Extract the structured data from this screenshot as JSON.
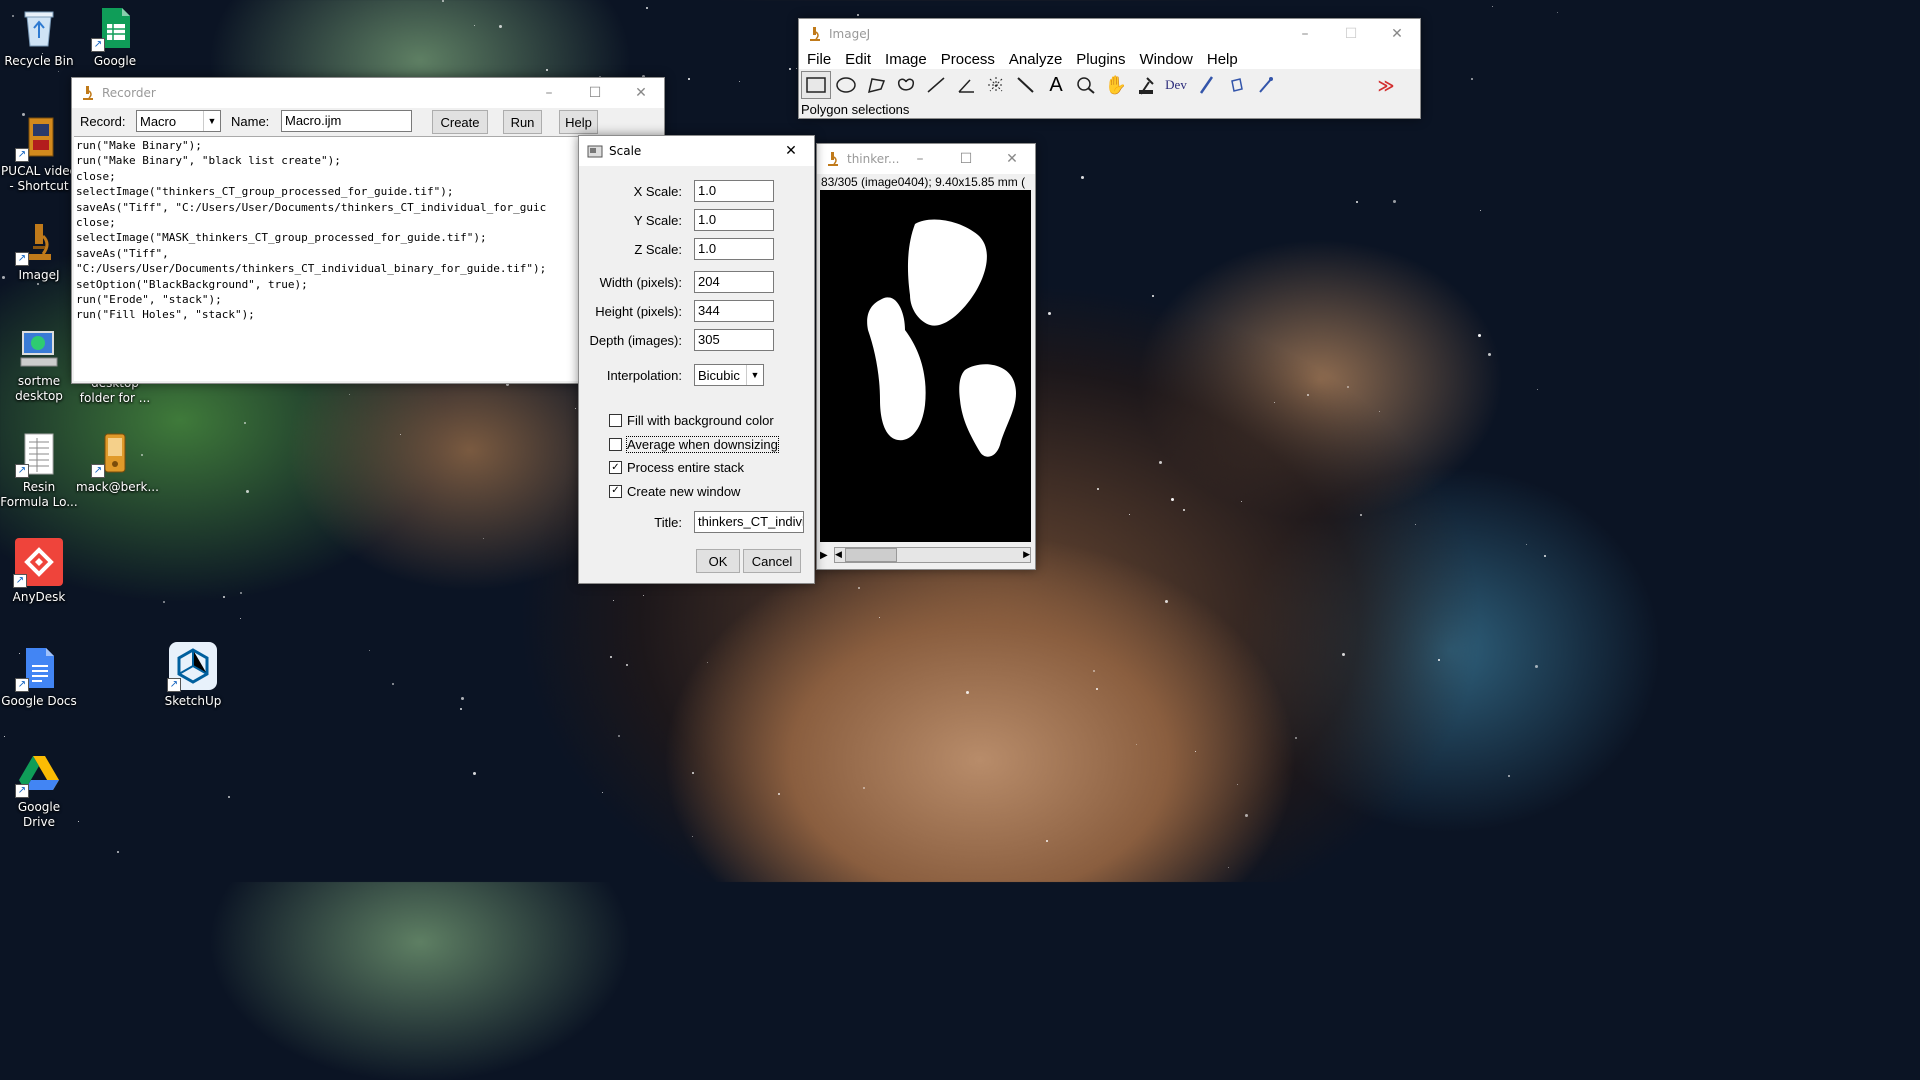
{
  "desktop": {
    "icons": [
      {
        "label": "Recycle Bin"
      },
      {
        "label": "Google"
      },
      {
        "label": "PUCAL video - Shortcut"
      },
      {
        "label": "ImageJ"
      },
      {
        "label": "sortme desktop"
      },
      {
        "label": "desktop folder for ..."
      },
      {
        "label": "Resin Formula Lo..."
      },
      {
        "label": "mack@berk..."
      },
      {
        "label": "AnyDesk"
      },
      {
        "label": "Google Docs"
      },
      {
        "label": "SketchUp"
      },
      {
        "label": "Google Drive"
      }
    ]
  },
  "recorder": {
    "title": "Recorder",
    "record_label": "Record:",
    "record_value": "Macro",
    "name_label": "Name:",
    "name_value": "Macro.ijm",
    "create_label": "Create",
    "run_label": "Run",
    "help_label": "Help",
    "code_lines": [
      "run(\"Make Binary\");",
      "run(\"Make Binary\", \"black list create\");",
      "close;",
      "selectImage(\"thinkers_CT_group_processed_for_guide.tif\");",
      "saveAs(\"Tiff\", \"C:/Users/User/Documents/thinkers_CT_individual_for_guic",
      "close;",
      "selectImage(\"MASK_thinkers_CT_group_processed_for_guide.tif\");",
      "saveAs(\"Tiff\",",
      "\"C:/Users/User/Documents/thinkers_CT_individual_binary_for_guide.tif\");",
      "setOption(\"BlackBackground\", true);",
      "run(\"Erode\", \"stack\");",
      "run(\"Fill Holes\", \"stack\");"
    ]
  },
  "imagej": {
    "title": "ImageJ",
    "menu": [
      "File",
      "Edit",
      "Image",
      "Process",
      "Analyze",
      "Plugins",
      "Window",
      "Help"
    ],
    "tools": [
      "rectangle-tool",
      "oval-tool",
      "polygon-tool",
      "freehand-tool",
      "line-tool",
      "angle-tool",
      "point-tool",
      "wand-tool",
      "text-tool",
      "magnifier-tool",
      "hand-tool",
      "dropper-tool",
      "dev-tool",
      "brush-tool",
      "flood-fill-tool",
      "pencil-tool",
      "empty-slot",
      "empty-slot",
      "empty-slot",
      "more-tools"
    ],
    "dev_label": "Dev",
    "status": "Polygon selections"
  },
  "image_window": {
    "title": "thinker...",
    "info": "83/305 (image0404); 9.40x15.85 mm ("
  },
  "scale": {
    "title": "Scale",
    "fields": [
      {
        "label": "X Scale:",
        "value": "1.0"
      },
      {
        "label": "Y Scale:",
        "value": "1.0"
      },
      {
        "label": "Z Scale:",
        "value": "1.0"
      },
      {
        "label": "Width (pixels):",
        "value": "204"
      },
      {
        "label": "Height (pixels):",
        "value": "344"
      },
      {
        "label": "Depth (images):",
        "value": "305"
      }
    ],
    "interpolation_label": "Interpolation:",
    "interpolation_value": "Bicubic",
    "checkboxes": [
      {
        "label": "Fill with background color",
        "checked": false
      },
      {
        "label": "Average when downsizing",
        "checked": false
      },
      {
        "label": "Process entire stack",
        "checked": true
      },
      {
        "label": "Create new window",
        "checked": true
      }
    ],
    "title_label": "Title:",
    "title_value": "thinkers_CT_indivi",
    "ok_label": "OK",
    "cancel_label": "Cancel"
  },
  "colors": {
    "ij_red": "#d32f2f",
    "anydesk_red": "#ef443b",
    "docs_blue": "#4285f4",
    "sheets_green": "#0f9d58"
  }
}
